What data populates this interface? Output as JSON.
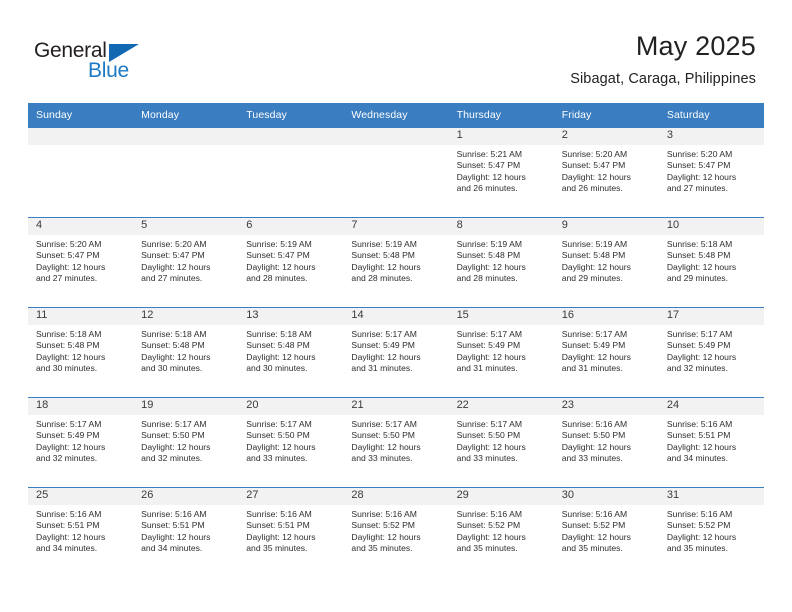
{
  "logo": {
    "word1": "General",
    "word2": "Blue",
    "triangle_color": "#1268b3",
    "word1_color": "#231f20",
    "word2_color": "#1e7ac4"
  },
  "header": {
    "title": "May 2025",
    "subtitle": "Sibagat, Caraga, Philippines"
  },
  "theme": {
    "header_bg": "#3a7dc0",
    "header_text": "#ffffff",
    "daynum_bg": "#f2f2f2",
    "grid_line": "#3a7dc0"
  },
  "weekday_headers": [
    "Sunday",
    "Monday",
    "Tuesday",
    "Wednesday",
    "Thursday",
    "Friday",
    "Saturday"
  ],
  "weeks": [
    {
      "days": [
        {
          "num": "",
          "empty": true,
          "sunrise": "",
          "sunset": "",
          "daylight1": "",
          "daylight2": ""
        },
        {
          "num": "",
          "empty": true,
          "sunrise": "",
          "sunset": "",
          "daylight1": "",
          "daylight2": ""
        },
        {
          "num": "",
          "empty": true,
          "sunrise": "",
          "sunset": "",
          "daylight1": "",
          "daylight2": ""
        },
        {
          "num": "",
          "empty": true,
          "sunrise": "",
          "sunset": "",
          "daylight1": "",
          "daylight2": ""
        },
        {
          "num": "1",
          "empty": false,
          "sunrise": "Sunrise: 5:21 AM",
          "sunset": "Sunset: 5:47 PM",
          "daylight1": "Daylight: 12 hours",
          "daylight2": "and 26 minutes."
        },
        {
          "num": "2",
          "empty": false,
          "sunrise": "Sunrise: 5:20 AM",
          "sunset": "Sunset: 5:47 PM",
          "daylight1": "Daylight: 12 hours",
          "daylight2": "and 26 minutes."
        },
        {
          "num": "3",
          "empty": false,
          "sunrise": "Sunrise: 5:20 AM",
          "sunset": "Sunset: 5:47 PM",
          "daylight1": "Daylight: 12 hours",
          "daylight2": "and 27 minutes."
        }
      ]
    },
    {
      "days": [
        {
          "num": "4",
          "empty": false,
          "sunrise": "Sunrise: 5:20 AM",
          "sunset": "Sunset: 5:47 PM",
          "daylight1": "Daylight: 12 hours",
          "daylight2": "and 27 minutes."
        },
        {
          "num": "5",
          "empty": false,
          "sunrise": "Sunrise: 5:20 AM",
          "sunset": "Sunset: 5:47 PM",
          "daylight1": "Daylight: 12 hours",
          "daylight2": "and 27 minutes."
        },
        {
          "num": "6",
          "empty": false,
          "sunrise": "Sunrise: 5:19 AM",
          "sunset": "Sunset: 5:47 PM",
          "daylight1": "Daylight: 12 hours",
          "daylight2": "and 28 minutes."
        },
        {
          "num": "7",
          "empty": false,
          "sunrise": "Sunrise: 5:19 AM",
          "sunset": "Sunset: 5:48 PM",
          "daylight1": "Daylight: 12 hours",
          "daylight2": "and 28 minutes."
        },
        {
          "num": "8",
          "empty": false,
          "sunrise": "Sunrise: 5:19 AM",
          "sunset": "Sunset: 5:48 PM",
          "daylight1": "Daylight: 12 hours",
          "daylight2": "and 28 minutes."
        },
        {
          "num": "9",
          "empty": false,
          "sunrise": "Sunrise: 5:19 AM",
          "sunset": "Sunset: 5:48 PM",
          "daylight1": "Daylight: 12 hours",
          "daylight2": "and 29 minutes."
        },
        {
          "num": "10",
          "empty": false,
          "sunrise": "Sunrise: 5:18 AM",
          "sunset": "Sunset: 5:48 PM",
          "daylight1": "Daylight: 12 hours",
          "daylight2": "and 29 minutes."
        }
      ]
    },
    {
      "days": [
        {
          "num": "11",
          "empty": false,
          "sunrise": "Sunrise: 5:18 AM",
          "sunset": "Sunset: 5:48 PM",
          "daylight1": "Daylight: 12 hours",
          "daylight2": "and 30 minutes."
        },
        {
          "num": "12",
          "empty": false,
          "sunrise": "Sunrise: 5:18 AM",
          "sunset": "Sunset: 5:48 PM",
          "daylight1": "Daylight: 12 hours",
          "daylight2": "and 30 minutes."
        },
        {
          "num": "13",
          "empty": false,
          "sunrise": "Sunrise: 5:18 AM",
          "sunset": "Sunset: 5:48 PM",
          "daylight1": "Daylight: 12 hours",
          "daylight2": "and 30 minutes."
        },
        {
          "num": "14",
          "empty": false,
          "sunrise": "Sunrise: 5:17 AM",
          "sunset": "Sunset: 5:49 PM",
          "daylight1": "Daylight: 12 hours",
          "daylight2": "and 31 minutes."
        },
        {
          "num": "15",
          "empty": false,
          "sunrise": "Sunrise: 5:17 AM",
          "sunset": "Sunset: 5:49 PM",
          "daylight1": "Daylight: 12 hours",
          "daylight2": "and 31 minutes."
        },
        {
          "num": "16",
          "empty": false,
          "sunrise": "Sunrise: 5:17 AM",
          "sunset": "Sunset: 5:49 PM",
          "daylight1": "Daylight: 12 hours",
          "daylight2": "and 31 minutes."
        },
        {
          "num": "17",
          "empty": false,
          "sunrise": "Sunrise: 5:17 AM",
          "sunset": "Sunset: 5:49 PM",
          "daylight1": "Daylight: 12 hours",
          "daylight2": "and 32 minutes."
        }
      ]
    },
    {
      "days": [
        {
          "num": "18",
          "empty": false,
          "sunrise": "Sunrise: 5:17 AM",
          "sunset": "Sunset: 5:49 PM",
          "daylight1": "Daylight: 12 hours",
          "daylight2": "and 32 minutes."
        },
        {
          "num": "19",
          "empty": false,
          "sunrise": "Sunrise: 5:17 AM",
          "sunset": "Sunset: 5:50 PM",
          "daylight1": "Daylight: 12 hours",
          "daylight2": "and 32 minutes."
        },
        {
          "num": "20",
          "empty": false,
          "sunrise": "Sunrise: 5:17 AM",
          "sunset": "Sunset: 5:50 PM",
          "daylight1": "Daylight: 12 hours",
          "daylight2": "and 33 minutes."
        },
        {
          "num": "21",
          "empty": false,
          "sunrise": "Sunrise: 5:17 AM",
          "sunset": "Sunset: 5:50 PM",
          "daylight1": "Daylight: 12 hours",
          "daylight2": "and 33 minutes."
        },
        {
          "num": "22",
          "empty": false,
          "sunrise": "Sunrise: 5:17 AM",
          "sunset": "Sunset: 5:50 PM",
          "daylight1": "Daylight: 12 hours",
          "daylight2": "and 33 minutes."
        },
        {
          "num": "23",
          "empty": false,
          "sunrise": "Sunrise: 5:16 AM",
          "sunset": "Sunset: 5:50 PM",
          "daylight1": "Daylight: 12 hours",
          "daylight2": "and 33 minutes."
        },
        {
          "num": "24",
          "empty": false,
          "sunrise": "Sunrise: 5:16 AM",
          "sunset": "Sunset: 5:51 PM",
          "daylight1": "Daylight: 12 hours",
          "daylight2": "and 34 minutes."
        }
      ]
    },
    {
      "days": [
        {
          "num": "25",
          "empty": false,
          "sunrise": "Sunrise: 5:16 AM",
          "sunset": "Sunset: 5:51 PM",
          "daylight1": "Daylight: 12 hours",
          "daylight2": "and 34 minutes."
        },
        {
          "num": "26",
          "empty": false,
          "sunrise": "Sunrise: 5:16 AM",
          "sunset": "Sunset: 5:51 PM",
          "daylight1": "Daylight: 12 hours",
          "daylight2": "and 34 minutes."
        },
        {
          "num": "27",
          "empty": false,
          "sunrise": "Sunrise: 5:16 AM",
          "sunset": "Sunset: 5:51 PM",
          "daylight1": "Daylight: 12 hours",
          "daylight2": "and 35 minutes."
        },
        {
          "num": "28",
          "empty": false,
          "sunrise": "Sunrise: 5:16 AM",
          "sunset": "Sunset: 5:52 PM",
          "daylight1": "Daylight: 12 hours",
          "daylight2": "and 35 minutes."
        },
        {
          "num": "29",
          "empty": false,
          "sunrise": "Sunrise: 5:16 AM",
          "sunset": "Sunset: 5:52 PM",
          "daylight1": "Daylight: 12 hours",
          "daylight2": "and 35 minutes."
        },
        {
          "num": "30",
          "empty": false,
          "sunrise": "Sunrise: 5:16 AM",
          "sunset": "Sunset: 5:52 PM",
          "daylight1": "Daylight: 12 hours",
          "daylight2": "and 35 minutes."
        },
        {
          "num": "31",
          "empty": false,
          "sunrise": "Sunrise: 5:16 AM",
          "sunset": "Sunset: 5:52 PM",
          "daylight1": "Daylight: 12 hours",
          "daylight2": "and 35 minutes."
        }
      ]
    }
  ]
}
